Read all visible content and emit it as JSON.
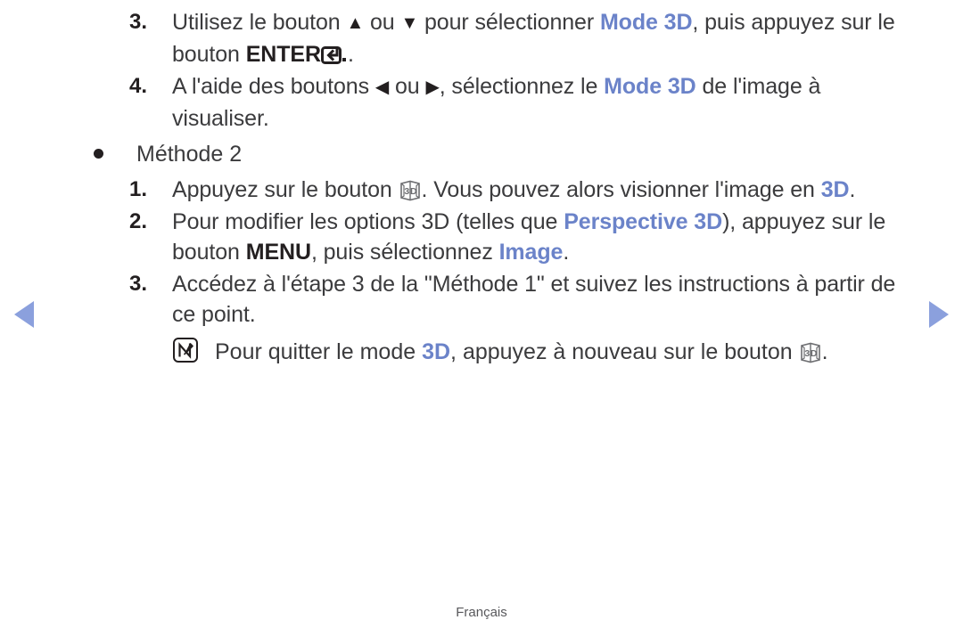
{
  "document": {
    "language_footer": "Français",
    "accent_blue": "#6b83c9",
    "text_color": "#3b3b3d"
  },
  "navigation": {
    "prev_label": "prev-page-arrow",
    "next_label": "next-page-arrow"
  },
  "steps": {
    "method1_step3": {
      "marker": "3.",
      "part1": "Utilisez le bouton ",
      "arrow_up": "▲",
      "part2": " ou ",
      "arrow_down": "▼",
      "part3": " pour sélectionner ",
      "highlight": "Mode 3D",
      "part4": ", puis appuyez sur le bouton ",
      "bold_label": "ENTER",
      "part5": "."
    },
    "method1_step4": {
      "marker": "4.",
      "part1": "A l'aide des boutons ",
      "arrow_left": "◀",
      "part2": " ou ",
      "arrow_right": "▶",
      "part3": ", sélectionnez le ",
      "highlight": "Mode 3D",
      "part4": " de l'image à visualiser."
    },
    "method2_heading": {
      "bullet": "•",
      "label": "Méthode 2"
    },
    "method2_step1": {
      "marker": "1.",
      "part1": "Appuyez sur le bouton ",
      "part2": ". Vous pouvez alors visionner l'image en ",
      "highlight": "3D",
      "part3": "."
    },
    "method2_step2": {
      "marker": "2.",
      "part1": "Pour modifier les options 3D (telles que ",
      "highlight1": "Perspective 3D",
      "part2": "), appuyez sur le bouton ",
      "bold_label": "MENU",
      "part3": ", puis sélectionnez ",
      "highlight2": "Image",
      "part4": "."
    },
    "method2_step3": {
      "marker": "3.",
      "text": "Accédez à l'étape 3 de la \"Méthode 1\" et suivez les instructions à partir de ce point."
    },
    "note": {
      "part1": "Pour quitter le mode ",
      "highlight": "3D",
      "part2": ", appuyez à nouveau sur le bouton ",
      "part3": "."
    }
  },
  "icons": {
    "enter": "enter-key-icon",
    "three_d": "3d-button-icon",
    "note": "note-icon"
  }
}
